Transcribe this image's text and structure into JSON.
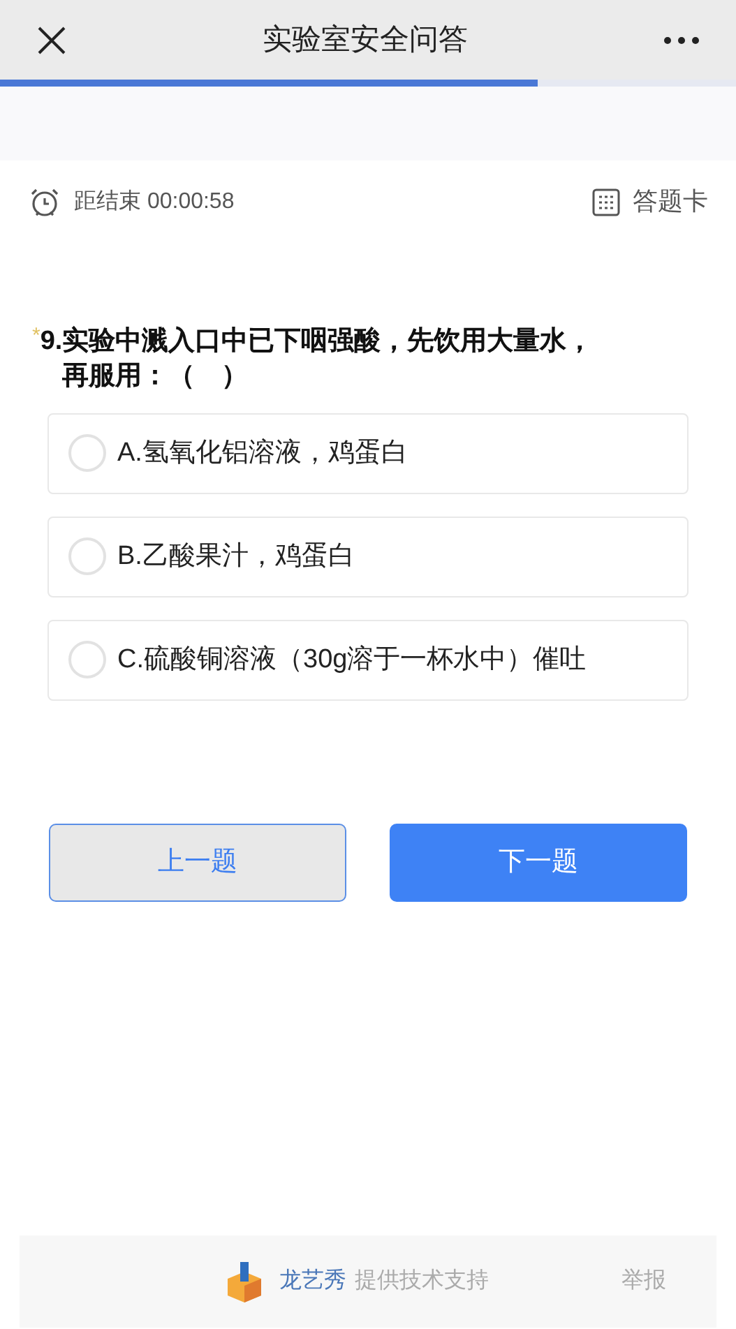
{
  "header": {
    "title": "实验室安全问答"
  },
  "progress": {
    "level": 0.73
  },
  "timer": {
    "label": "距结束 00:00:58"
  },
  "answer_card": {
    "label": "答题卡"
  },
  "question": {
    "required_mark": "*",
    "number": "9.",
    "text": "实验中溅入口中已下咽强酸，先饮用大量水，再服用：（　）"
  },
  "options": [
    {
      "text": "A.氢氧化铝溶液，鸡蛋白",
      "selected": false
    },
    {
      "text": "B.乙酸果汁，鸡蛋白",
      "selected": false
    },
    {
      "text": "C.硫酸铜溶液（30g溶于一杯水中）催吐",
      "selected": false
    }
  ],
  "buttons": [
    {
      "label": "上一题",
      "kind": "secondary"
    },
    {
      "label": "下一题",
      "kind": "primary"
    }
  ],
  "footer": {
    "brand": "龙艺秀",
    "credit": "提供技术支持",
    "report": "举报"
  }
}
